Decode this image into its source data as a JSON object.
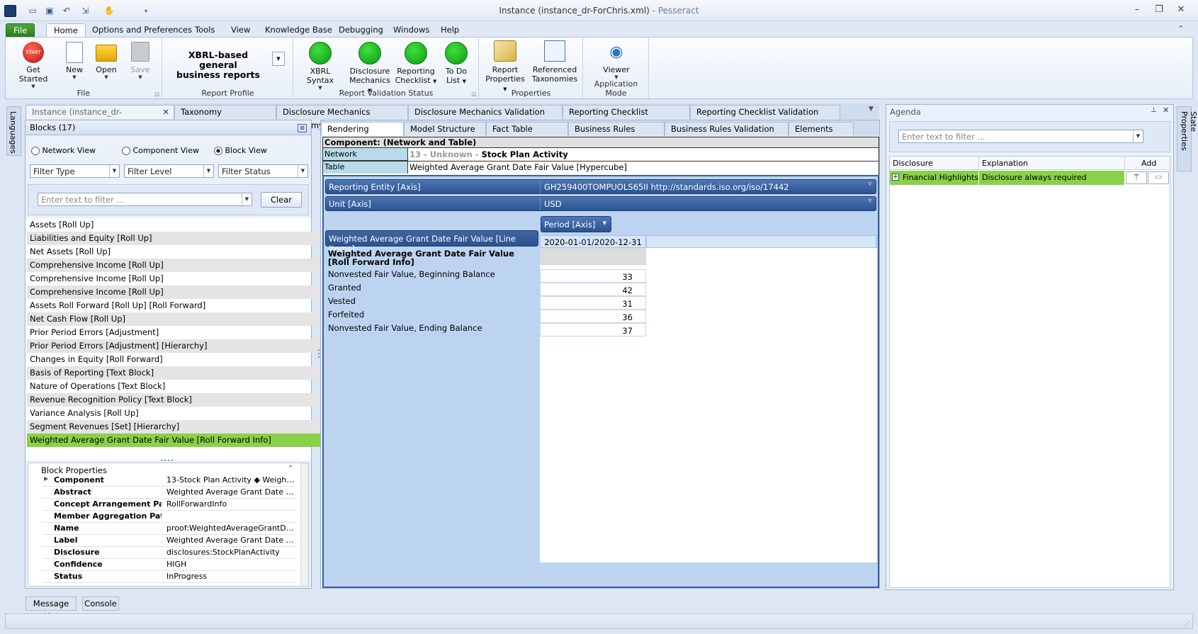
{
  "window": {
    "title_file": "Instance (instance_dr-ForChris.xml)",
    "title_sep": " - ",
    "title_app": "Pesseract"
  },
  "ribbon_tabs": [
    "File",
    "Home",
    "Options and Preferences",
    "Tools",
    "View",
    "Knowledge Base",
    "Debugging",
    "Windows",
    "Help"
  ],
  "ribbon": {
    "file_group": {
      "label": "File",
      "get_started": "Get Started",
      "new": "New",
      "open": "Open",
      "save": "Save",
      "start_badge": "START"
    },
    "report_profile": {
      "label": "Report Profile",
      "value_line1": "XBRL-based general",
      "value_line2": "business reports"
    },
    "validation": {
      "label": "Report Validation Status",
      "xbrl_syntax": "XBRL Syntax",
      "dm_1": "Disclosure",
      "dm_2": "Mechanics",
      "rc_1": "Reporting",
      "rc_2": "Checklist",
      "todo_1": "To Do",
      "todo_2": "List"
    },
    "properties": {
      "label": "Properties",
      "rp_1": "Report",
      "rp_2": "Properties",
      "rt_1": "Referenced",
      "rt_2": "Taxonomies"
    },
    "app_mode": {
      "label": "Application Mode",
      "viewer": "Viewer"
    }
  },
  "side_tabs": {
    "left": "Languages",
    "right": "State Properties"
  },
  "doc_tabs": [
    "Instance (instance_dr-ForChris.xml)",
    "Taxonomy (report.xsd)",
    "Disclosure Mechanics Taxonomy",
    "Disclosure Mechanics Validation Result",
    "Reporting Checklist Taxonomy",
    "Reporting Checklist Validation Result"
  ],
  "blocks": {
    "header": "Blocks (17)",
    "views": [
      "Network View",
      "Component View",
      "Block View"
    ],
    "selected_view": "Block View",
    "filters": [
      "Filter Type",
      "Filter Level",
      "Filter Status"
    ],
    "search_placeholder": "Enter text to filter ...",
    "clear": "Clear",
    "items": [
      "Assets [Roll Up]",
      "Liabilities and Equity [Roll Up]",
      "Net Assets [Roll Up]",
      "Comprehensive Income [Roll Up]",
      "Comprehensive Income [Roll Up]",
      "Comprehensive Income [Roll Up]",
      "Assets Roll Forward [Roll Up] [Roll Forward]",
      "Net Cash Flow [Roll Up]",
      "Prior Period Errors [Adjustment]",
      "Prior Period Errors [Adjustment] [Hierarchy]",
      "Changes in Equity [Roll Forward]",
      "Basis of Reporting [Text Block]",
      "Nature of Operations [Text Block]",
      "Revenue Recognition Policy [Text Block]",
      "Variance Analysis  [Roll Up]",
      "Segment Revenues [Set] [Hierarchy]",
      "Weighted Average Grant Date Fair Value [Roll Forward Info]"
    ],
    "selected_index": 16
  },
  "block_properties": {
    "header": "Block Properties",
    "rows": [
      {
        "k": "Component",
        "v": "13-Stock Plan Activity ◆ Weighted..."
      },
      {
        "k": "Abstract",
        "v": "Weighted Average Grant Date Fair ..."
      },
      {
        "k": "Concept Arrangement Patte",
        "v": "RollForwardInfo"
      },
      {
        "k": "Member Aggregation Patte",
        "v": ""
      },
      {
        "k": "Name",
        "v": "proof:WeightedAverageGrantDate..."
      },
      {
        "k": "Label",
        "v": "Weighted Average Grant Date Fair ..."
      },
      {
        "k": "Disclosure",
        "v": "disclosures:StockPlanActivity"
      },
      {
        "k": "Confidence",
        "v": "HIGH"
      },
      {
        "k": "Status",
        "v": "InProgress"
      }
    ]
  },
  "render_tabs": [
    "Rendering",
    "Model Structure",
    "Fact Table",
    "Business Rules Structure",
    "Business Rules Validation Results",
    "Elements"
  ],
  "component": {
    "title": "Component: (Network and Table)",
    "network_label": "Network",
    "network_prefix": "13 - Unknown - ",
    "network_value": "Stock Plan Activity",
    "table_label": "Table",
    "table_value": "Weighted Average Grant Date Fair Value [Hypercube]"
  },
  "axes": {
    "reporting_entity_label": "Reporting Entity [Axis]",
    "reporting_entity_value": "GH259400TOMPUOLS65II http://standards.iso.org/iso/17442",
    "unit_label": "Unit [Axis]",
    "unit_value": "USD",
    "period_label": "Period [Axis]",
    "line_items_label": "Weighted Average Grant Date Fair Value [Line Items]",
    "period_value": "2020-01-01/2020-12-31"
  },
  "grid": {
    "group_label": "Weighted Average Grant Date Fair Value [Roll Forward Info]",
    "rows": [
      {
        "label": "Nonvested Fair Value, Beginning Balance",
        "value": "33"
      },
      {
        "label": "Granted",
        "value": "42"
      },
      {
        "label": "Vested",
        "value": "31"
      },
      {
        "label": "Forfeited",
        "value": "36"
      },
      {
        "label": "Nonvested Fair Value, Ending Balance",
        "value": "37"
      }
    ]
  },
  "agenda": {
    "header": "Agenda",
    "search_placeholder": "Enter text to filter ...",
    "col_disclosure": "Disclosure",
    "col_explanation": "Explanation",
    "col_add": "Add",
    "row_disclosure": "Financial Highlights",
    "row_explanation": "Disclosure always required"
  },
  "bottom_tabs": [
    "Message List",
    "Console"
  ],
  "colors": {
    "selected_green": "#8ad14a",
    "axis_blue": "#2b5291",
    "status_green": "#0a9a10"
  }
}
